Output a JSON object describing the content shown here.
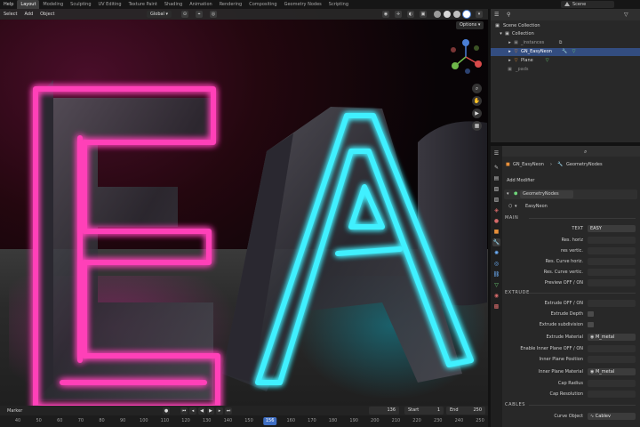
{
  "topbar": {
    "menus": [
      "Help"
    ],
    "workspaces": [
      "Layout",
      "Modeling",
      "Sculpting",
      "UV Editing",
      "Texture Paint",
      "Shading",
      "Animation",
      "Rendering",
      "Compositing",
      "Geometry Nodes",
      "Scripting"
    ],
    "active_workspace": "Layout",
    "scene": "Scene"
  },
  "viewport": {
    "menus": [
      "Select",
      "Add",
      "Object"
    ],
    "transform_orientation": "Global",
    "options_label": "Options",
    "gizmo_axes": [
      "X",
      "Y",
      "Z"
    ]
  },
  "timeline": {
    "marker_label": "Marker",
    "current_frame": "136",
    "start_label": "Start",
    "start_value": "1",
    "end_label": "End",
    "end_value": "250",
    "ticks": [
      "40",
      "50",
      "60",
      "70",
      "80",
      "90",
      "100",
      "110",
      "120",
      "130",
      "140",
      "150",
      "156",
      "160",
      "170",
      "180",
      "190",
      "200",
      "210",
      "220",
      "230",
      "240",
      "250"
    ],
    "ruler_current": "156"
  },
  "outliner": {
    "items": [
      {
        "label": "Scene Collection"
      },
      {
        "label": "Collection"
      },
      {
        "label": "_instances"
      },
      {
        "label": "GN_EasyNeon"
      },
      {
        "label": "Plane"
      },
      {
        "label": "_pads"
      }
    ]
  },
  "properties": {
    "breadcrumb_object": "GN_EasyNeon",
    "breadcrumb_modifier": "GeometryNodes",
    "add_modifier": "Add Modifier",
    "modifier_name": "GeometryNodes",
    "node_group": "EasyNeon",
    "sections": {
      "main": "MAIN",
      "extrude": "EXTRUDE",
      "cables": "CABLES"
    },
    "main_rows": [
      {
        "label": "TEXT",
        "value": "EASY"
      },
      {
        "label": "Res. horiz",
        "value": ""
      },
      {
        "label": "res vertic.",
        "value": ""
      },
      {
        "label": "Res. Curve horiz.",
        "value": ""
      },
      {
        "label": "Res. Curve vertic.",
        "value": ""
      },
      {
        "label": "Preview OFF / ON",
        "value": ""
      }
    ],
    "extrude_rows": [
      {
        "label": "Extrude OFF / ON",
        "value": ""
      },
      {
        "label": "Extrude Depth",
        "value": ""
      },
      {
        "label": "Extrude subdivision",
        "value": ""
      },
      {
        "label": "Extrude Material",
        "value": "M_metal"
      },
      {
        "label": "Enable Inner Plane OFF / ON",
        "value": ""
      },
      {
        "label": "Inner Plane Position",
        "value": ""
      },
      {
        "label": "Inner Plane Material",
        "value": "M_metal"
      },
      {
        "label": "Cap Radius",
        "value": ""
      },
      {
        "label": "Cap Resolution",
        "value": ""
      }
    ],
    "cables_rows": [
      {
        "label": "Curve Object",
        "value": "Cablev"
      }
    ]
  },
  "colors": {
    "neon_pink": "#ff3fb8",
    "neon_cyan": "#3ff0ff",
    "selection_blue": "#334d80",
    "accent_orange": "#e8903a",
    "timeline_current": "#3f6fc4"
  }
}
